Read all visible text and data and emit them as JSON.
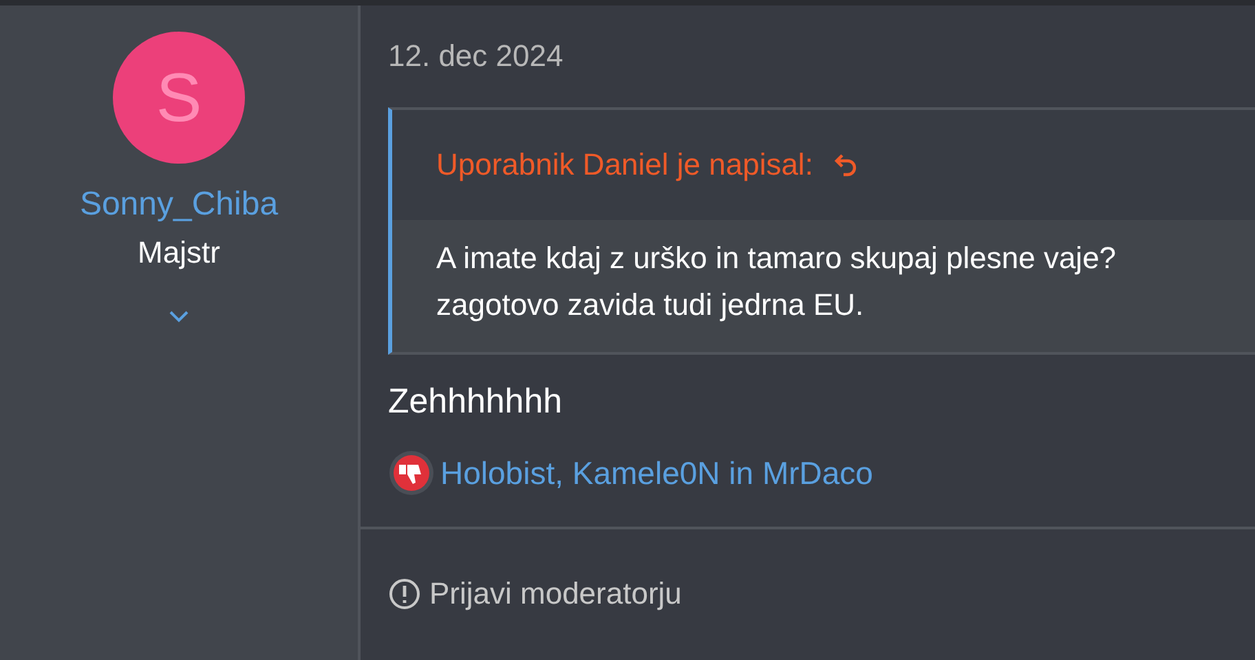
{
  "author": {
    "avatar_letter": "S",
    "name": "Sonny_Chiba",
    "rank": "Majstr"
  },
  "post": {
    "date": "12. dec 2024",
    "quote": {
      "header": "Uporabnik Daniel je napisal:",
      "lines": [
        "A imate kdaj z urško in tamaro skupaj plesne vaje?",
        "zagotovo zavida tudi jedrna EU."
      ]
    },
    "body": "Zehhhhhhh",
    "reactions": {
      "users": "Holobist, Kamele0N in MrDaco"
    },
    "report": "Prijavi moderatorju"
  }
}
